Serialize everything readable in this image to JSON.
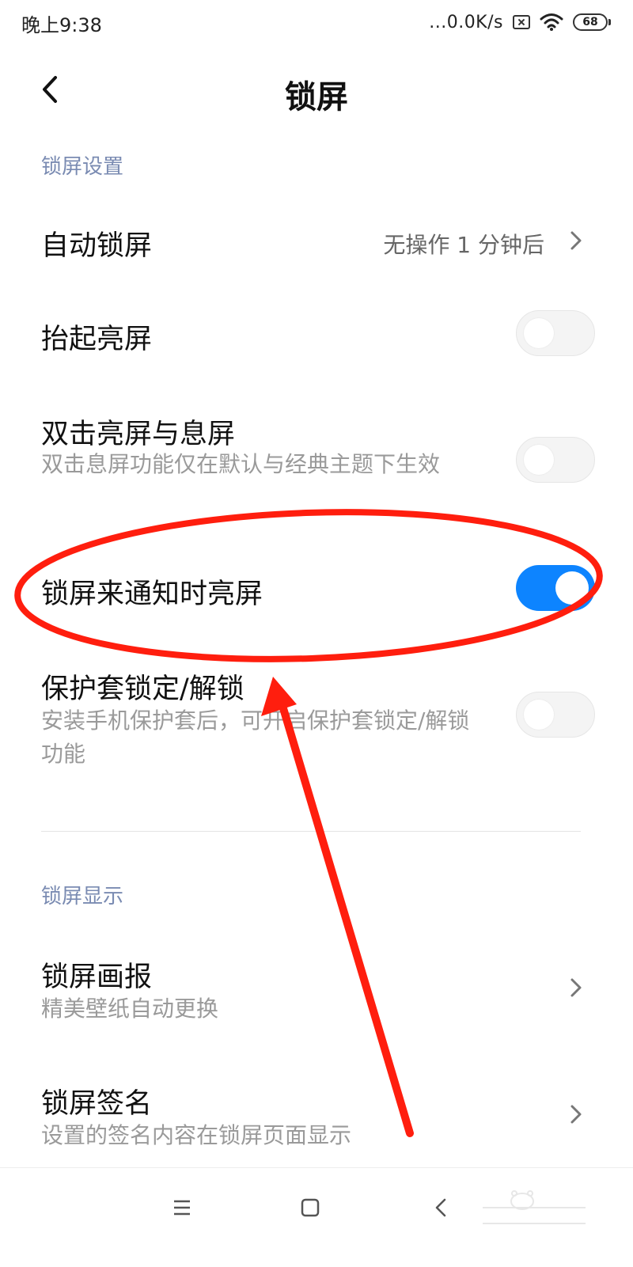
{
  "status_bar": {
    "time": "晚上9:38",
    "network_speed": "...0.0K/s",
    "battery_level": "68"
  },
  "header": {
    "title": "锁屏"
  },
  "sections": {
    "settings_title": "锁屏设置",
    "display_title": "锁屏显示"
  },
  "rows": {
    "auto_lock": {
      "title": "自动锁屏",
      "value": "无操作 1 分钟后"
    },
    "raise_to_wake": {
      "title": "抬起亮屏",
      "enabled": false
    },
    "double_tap": {
      "title": "双击亮屏与息屏",
      "subtitle": "双击息屏功能仅在默认与经典主题下生效",
      "enabled": false
    },
    "notification_wake": {
      "title": "锁屏来通知时亮屏",
      "enabled": true
    },
    "cover_lock": {
      "title": "保护套锁定/解锁",
      "subtitle": "安装手机保护套后，可开启保护套锁定/解锁功能",
      "enabled": false
    },
    "wallpaper_carousel": {
      "title": "锁屏画报",
      "subtitle": "精美壁纸自动更换"
    },
    "signature": {
      "title": "锁屏签名",
      "subtitle": "设置的签名内容在锁屏页面显示"
    }
  },
  "colors": {
    "accent": "#0d84ff",
    "section_title": "#7a8bb2",
    "annotation": "#ff1e0e"
  },
  "icons": {
    "back": "back-arrow-icon",
    "chevron": "chevron-right-icon",
    "nav_menu": "menu-icon",
    "nav_home": "home-icon",
    "nav_back": "back-icon"
  }
}
